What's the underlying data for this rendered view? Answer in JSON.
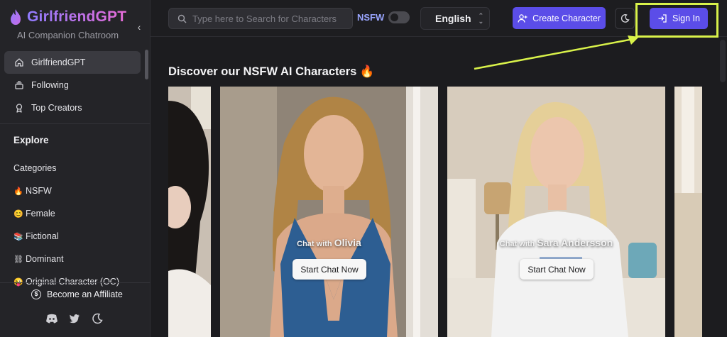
{
  "brand": {
    "name": "GirlfriendGPT",
    "subtitle": "AI Companion Chatroom"
  },
  "nav": [
    {
      "label": "GirlfriendGPT",
      "icon": "home-icon",
      "active": true
    },
    {
      "label": "Following",
      "icon": "stack-icon",
      "active": false
    },
    {
      "label": "Top Creators",
      "icon": "award-icon",
      "active": false
    }
  ],
  "explore": {
    "title": "Explore",
    "items": [
      {
        "emoji": "",
        "label": "Categories"
      },
      {
        "emoji": "🔥",
        "label": "NSFW"
      },
      {
        "emoji": "😊",
        "label": "Female"
      },
      {
        "emoji": "📚",
        "label": "Fictional"
      },
      {
        "emoji": "⛓",
        "label": "Dominant"
      },
      {
        "emoji": "😜",
        "label": "Original Character (OC)"
      }
    ]
  },
  "footer": {
    "affiliate_label": "Become an Affiliate",
    "affiliate_icon": "dollar-coin-icon"
  },
  "topbar": {
    "search_placeholder": "Type here to Search for Characters",
    "nsfw_label": "NSFW",
    "nsfw_enabled": false,
    "language": "English",
    "create_label": "Create Character",
    "signin_label": "Sign In"
  },
  "main": {
    "title": "Discover our NSFW AI Characters 🔥",
    "cards": [
      {
        "chat_prefix": "Chat with",
        "name": "Olivia",
        "button": "Start Chat Now"
      },
      {
        "chat_prefix": "Chat with",
        "name": "Sara Andersson",
        "button": "Start Chat Now"
      }
    ]
  },
  "colors": {
    "accent": "#5b4de8",
    "highlight": "#d9f24a",
    "background": "#1c1c1f"
  }
}
